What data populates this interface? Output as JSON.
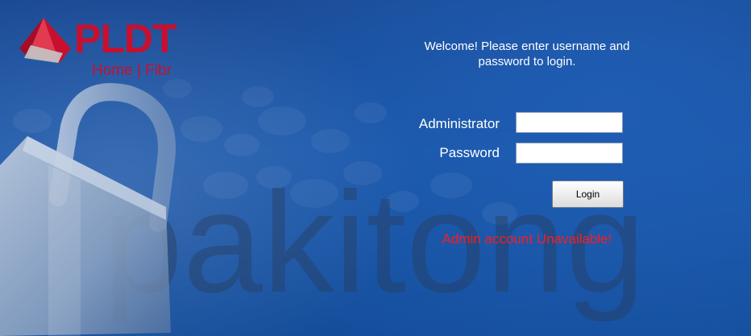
{
  "brand": {
    "name": "PLDT",
    "tagline": "Home | Fibr",
    "color": "#c8102e"
  },
  "watermark": "pakitong",
  "login": {
    "welcome": "Welcome! Please enter username and password to login.",
    "username_label": "Administrator",
    "username_value": "",
    "password_label": "Password",
    "password_value": "",
    "button_label": "Login",
    "error_message": "Admin account Unavailable!",
    "error_color": "#ff1a1a"
  },
  "icons": {
    "logo": "pldt-logo-icon",
    "padlock": "padlock-icon"
  }
}
